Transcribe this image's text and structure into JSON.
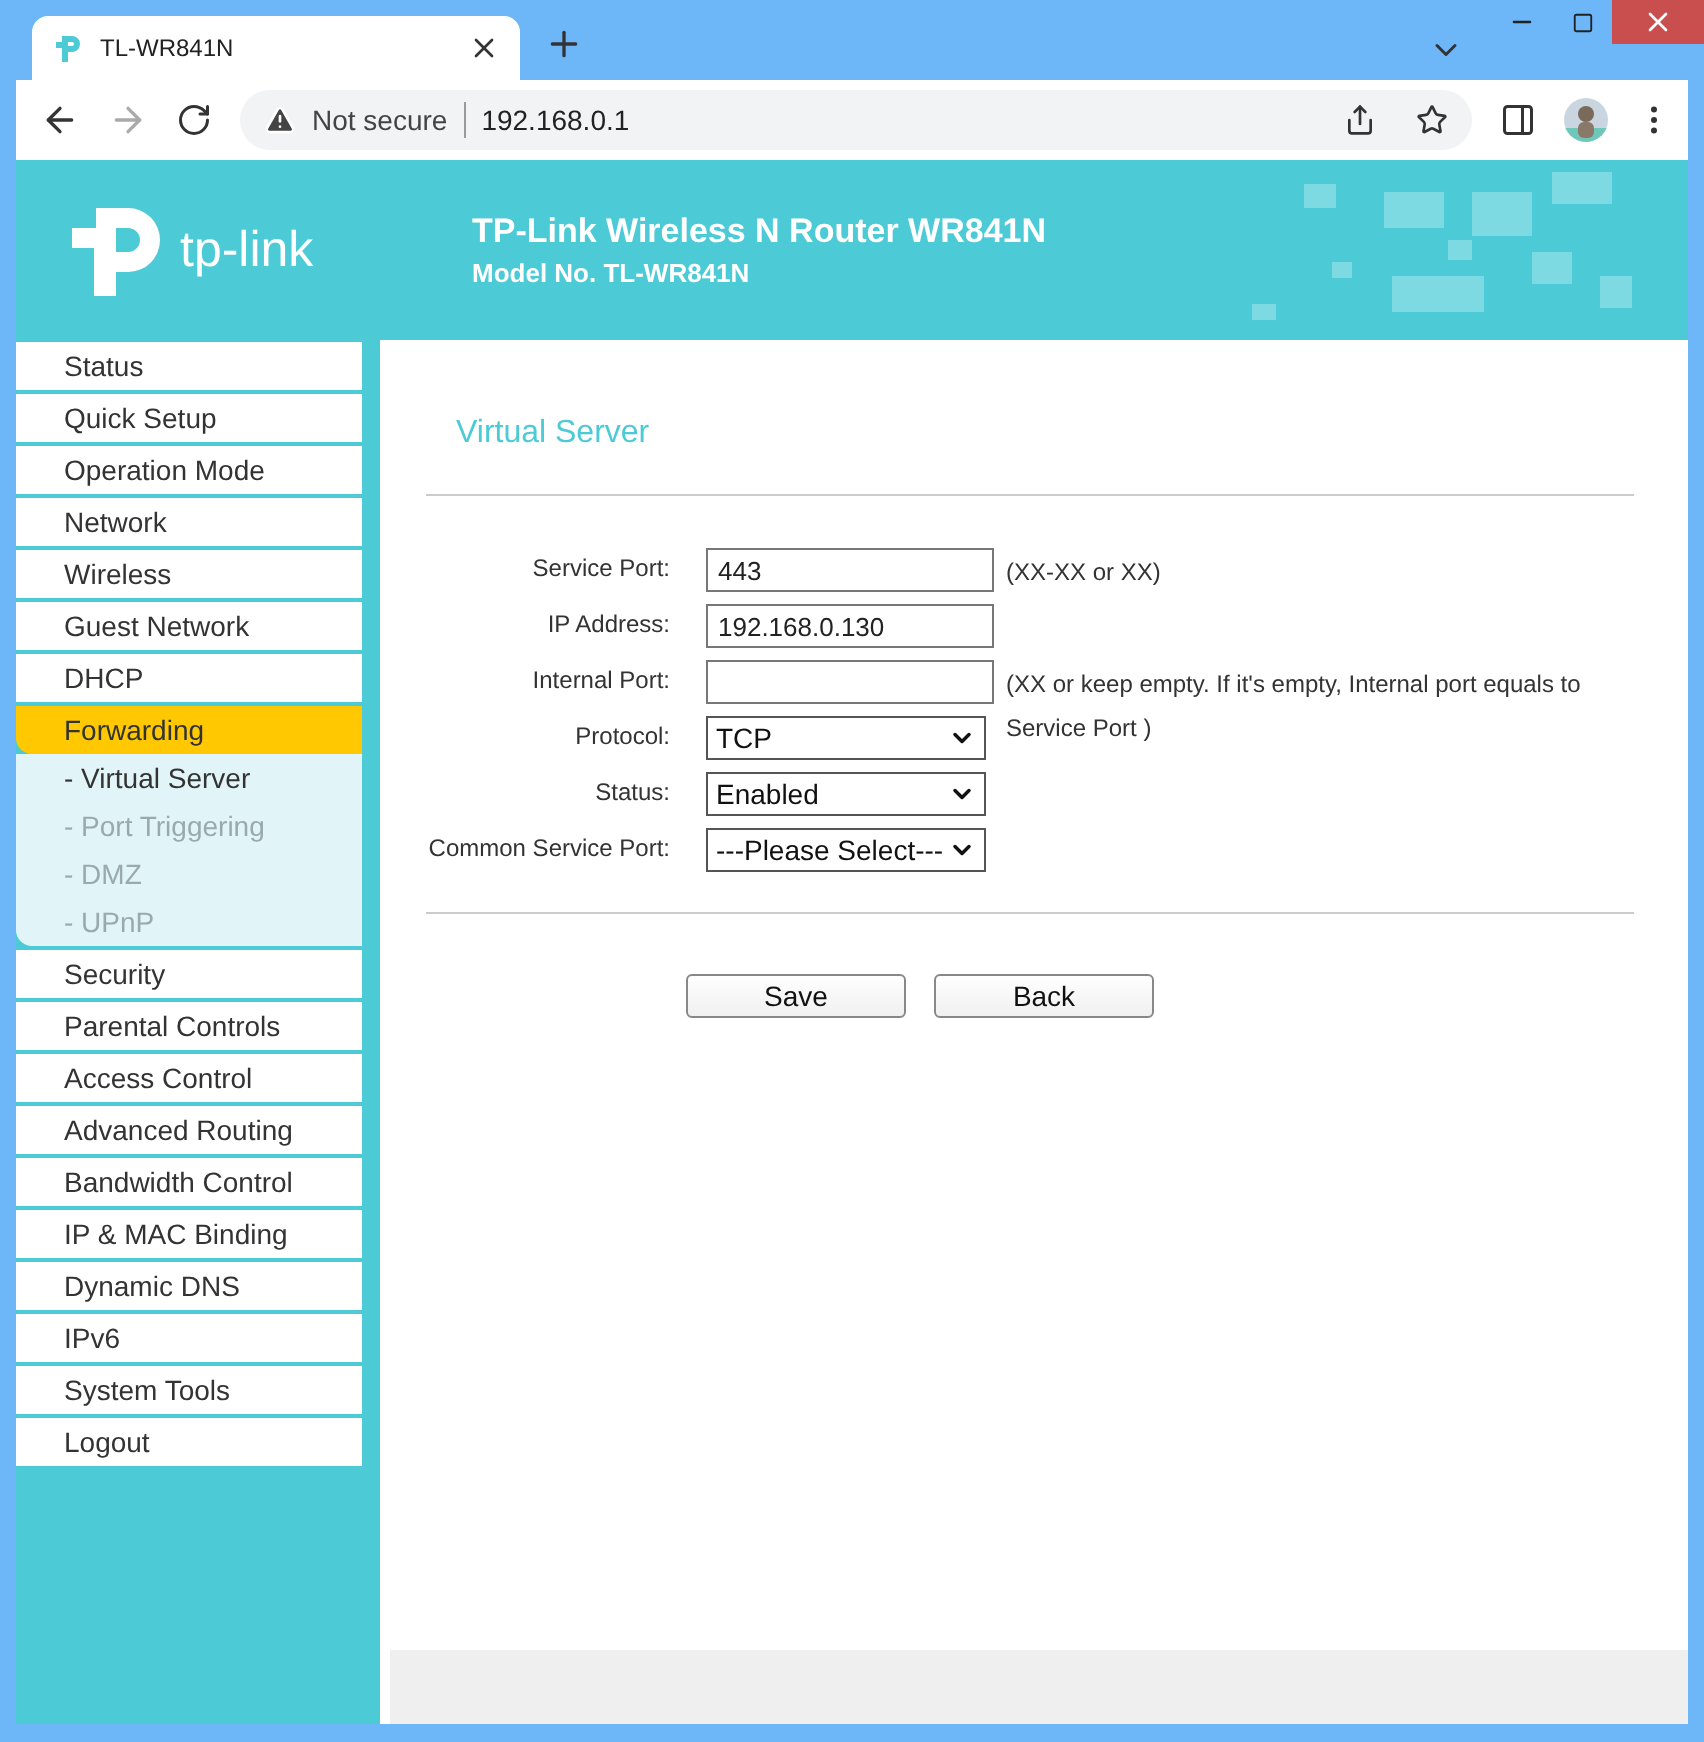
{
  "browser": {
    "tab": {
      "title": "TL-WR841N"
    },
    "forward_disabled": true,
    "address": {
      "security": "Not secure",
      "url": "192.168.0.1"
    }
  },
  "header": {
    "logo_text": "tp-link",
    "title": "TP-Link Wireless N Router WR841N",
    "model": "Model No. TL-WR841N"
  },
  "sidebar": {
    "items": [
      {
        "label": "Status",
        "selected": false
      },
      {
        "label": "Quick Setup",
        "selected": false
      },
      {
        "label": "Operation Mode",
        "selected": false
      },
      {
        "label": "Network",
        "selected": false
      },
      {
        "label": "Wireless",
        "selected": false
      },
      {
        "label": "Guest Network",
        "selected": false
      },
      {
        "label": "DHCP",
        "selected": false
      },
      {
        "label": "Forwarding",
        "selected": true,
        "children": [
          {
            "label": "- Virtual Server",
            "selected": true
          },
          {
            "label": "- Port Triggering",
            "selected": false
          },
          {
            "label": "- DMZ",
            "selected": false
          },
          {
            "label": "- UPnP",
            "selected": false
          }
        ]
      },
      {
        "label": "Security",
        "selected": false
      },
      {
        "label": "Parental Controls",
        "selected": false
      },
      {
        "label": "Access Control",
        "selected": false
      },
      {
        "label": "Advanced Routing",
        "selected": false
      },
      {
        "label": "Bandwidth Control",
        "selected": false
      },
      {
        "label": "IP & MAC Binding",
        "selected": false
      },
      {
        "label": "Dynamic DNS",
        "selected": false
      },
      {
        "label": "IPv6",
        "selected": false
      },
      {
        "label": "System Tools",
        "selected": false
      },
      {
        "label": "Logout",
        "selected": false
      }
    ]
  },
  "content": {
    "title": "Virtual Server",
    "fields": [
      {
        "kind": "text",
        "label": "Service Port:",
        "value": "443",
        "hint": "(XX-XX or XX)"
      },
      {
        "kind": "text",
        "label": "IP Address:",
        "value": "192.168.0.130"
      },
      {
        "kind": "text",
        "label": "Internal Port:",
        "hint": "(XX or keep empty. If it's empty, Internal port equals to Service Port )"
      },
      {
        "kind": "select",
        "label": "Protocol:",
        "value": "TCP"
      },
      {
        "kind": "select",
        "label": "Status:",
        "value": "Enabled"
      },
      {
        "kind": "select",
        "label": "Common Service Port:",
        "value": "---Please Select---"
      }
    ],
    "buttons": [
      "Save",
      "Back"
    ]
  }
}
